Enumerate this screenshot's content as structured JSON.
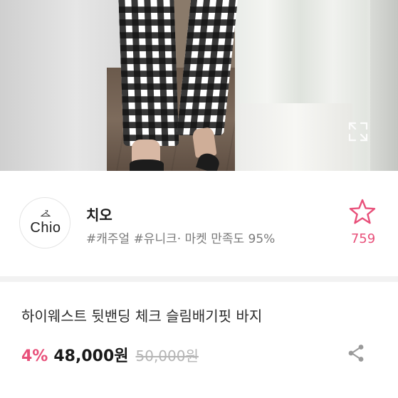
{
  "shop": {
    "logo_text": "Chio",
    "name": "치오",
    "tags": "#캐주얼 #유니크· 마켓 만족도 95%",
    "favorite_count": "759"
  },
  "product": {
    "title": "하이웨스트 뒷밴딩 체크 슬림배기핏 바지",
    "discount": "4%",
    "price": "48,000원",
    "original_price": "50,000원"
  },
  "icons": {
    "expand": "expand-icon",
    "favorite": "star-icon",
    "share": "share-icon",
    "logo_hanger": "hanger-icon"
  },
  "colors": {
    "accent": "#e8507a",
    "muted_text": "#7a7a7a",
    "strike_text": "#b5b5b5"
  }
}
